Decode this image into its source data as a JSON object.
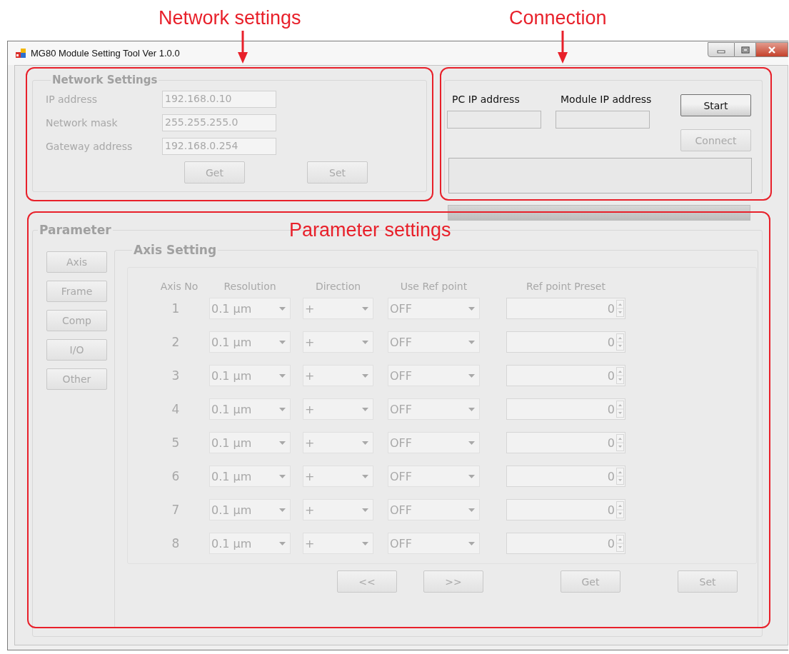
{
  "annotations": [
    {
      "kind": "arrow",
      "text": "Network settings"
    },
    {
      "kind": "arrow",
      "text": "Connection"
    },
    {
      "kind": "inline",
      "text": "Parameter settings"
    }
  ],
  "window": {
    "title": "MG80 Module Setting Tool Ver 1.0.0"
  },
  "network_settings": {
    "title": "Network Settings",
    "disabled": true,
    "fields": [
      {
        "label": "IP address",
        "value": "192.168.0.10"
      },
      {
        "label": "Network mask",
        "value": "255.255.255.0"
      },
      {
        "label": "Gateway address",
        "value": "192.168.0.254"
      }
    ],
    "buttons": [
      "Get",
      "Set"
    ]
  },
  "connection": {
    "fields": [
      {
        "label": "PC IP address"
      },
      {
        "label": "Module IP address"
      }
    ],
    "buttons": [
      {
        "label": "Start",
        "disabled": false
      },
      {
        "label": "Connect",
        "disabled": true
      }
    ]
  },
  "progress": {
    "level": 0
  },
  "parameter": {
    "title": "Parameter",
    "disabled": true,
    "nav_buttons": [
      "Axis",
      "Frame",
      "Comp",
      "I/O",
      "Other"
    ],
    "axis_setting": {
      "title": "Axis Setting",
      "columns": [
        "Axis No",
        "Resolution",
        "Direction",
        "Use Ref point",
        "Ref point Preset"
      ],
      "rows": [
        {
          "axis_no": "1",
          "resolution": "0.1 μm",
          "direction": "+",
          "use_ref_point": "OFF",
          "preset": "0"
        },
        {
          "axis_no": "2",
          "resolution": "0.1 μm",
          "direction": "+",
          "use_ref_point": "OFF",
          "preset": "0"
        },
        {
          "axis_no": "3",
          "resolution": "0.1 μm",
          "direction": "+",
          "use_ref_point": "OFF",
          "preset": "0"
        },
        {
          "axis_no": "4",
          "resolution": "0.1 μm",
          "direction": "+",
          "use_ref_point": "OFF",
          "preset": "0"
        },
        {
          "axis_no": "5",
          "resolution": "0.1 μm",
          "direction": "+",
          "use_ref_point": "OFF",
          "preset": "0"
        },
        {
          "axis_no": "6",
          "resolution": "0.1 μm",
          "direction": "+",
          "use_ref_point": "OFF",
          "preset": "0"
        },
        {
          "axis_no": "7",
          "resolution": "0.1 μm",
          "direction": "+",
          "use_ref_point": "OFF",
          "preset": "0"
        },
        {
          "axis_no": "8",
          "resolution": "0.1 μm",
          "direction": "+",
          "use_ref_point": "OFF",
          "preset": "0"
        }
      ],
      "buttons": [
        "<<",
        ">>",
        "Get",
        "Set"
      ]
    }
  }
}
